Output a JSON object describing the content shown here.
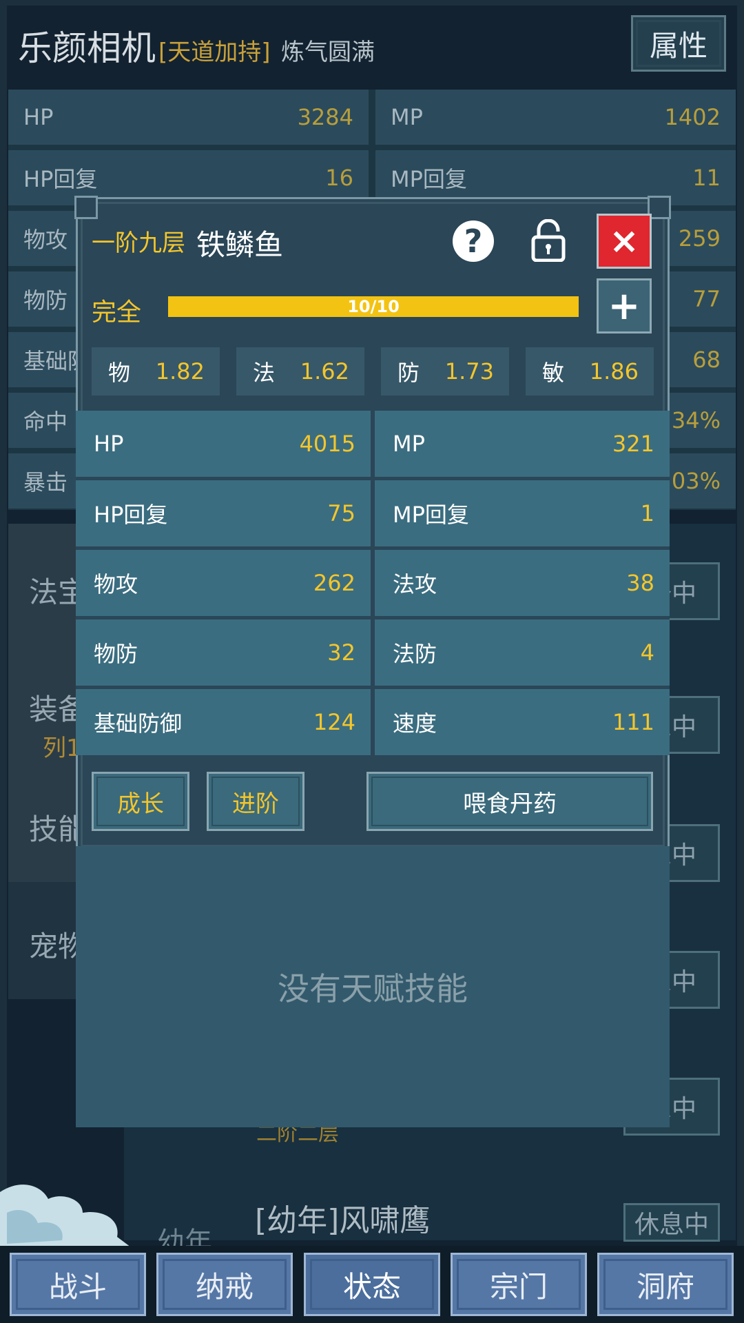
{
  "background": {
    "character_name": "乐颜相机",
    "tag": "[天道加持]",
    "realm": "炼气圆满",
    "attr_button": "属性",
    "stats": [
      {
        "label": "HP",
        "value": "3284"
      },
      {
        "label": "MP",
        "value": "1402"
      },
      {
        "label": "HP回复",
        "value": "16"
      },
      {
        "label": "MP回复",
        "value": "11"
      },
      {
        "label": "物攻",
        "value": ""
      },
      {
        "label": "",
        "value": "259"
      },
      {
        "label": "物防",
        "value": ""
      },
      {
        "label": "",
        "value": "77"
      },
      {
        "label": "基础防",
        "value": ""
      },
      {
        "label": "",
        "value": "68"
      },
      {
        "label": "命中",
        "value": ""
      },
      {
        "label": "",
        "value": ".34%"
      },
      {
        "label": "暴击",
        "value": ""
      },
      {
        "label": "",
        "value": ".03%"
      }
    ],
    "sidebar": {
      "fabao": "法宝",
      "equip": "装备",
      "equip_sub": "列1",
      "skill": "技能",
      "pet": "宠物"
    },
    "status_buttons": [
      "备中",
      "息中",
      "息中",
      "息中",
      "息中",
      "休息中"
    ],
    "pet_entry": {
      "name": "[幼年]风啸鹰",
      "age": "幼年",
      "level": "二阶二层"
    }
  },
  "dialog": {
    "rank": "一阶九层",
    "name": "铁鳞鱼",
    "help_glyph": "?",
    "close_glyph": "×",
    "plus_glyph": "+",
    "progress": {
      "label": "完全",
      "current": 10,
      "max": 10,
      "text": "10/10"
    },
    "growth": [
      {
        "label": "物",
        "value": "1.82"
      },
      {
        "label": "法",
        "value": "1.62"
      },
      {
        "label": "防",
        "value": "1.73"
      },
      {
        "label": "敏",
        "value": "1.86"
      }
    ],
    "stats": [
      {
        "label": "HP",
        "value": "4015"
      },
      {
        "label": "MP",
        "value": "321"
      },
      {
        "label": "HP回复",
        "value": "75"
      },
      {
        "label": "MP回复",
        "value": "1"
      },
      {
        "label": "物攻",
        "value": "262"
      },
      {
        "label": "法攻",
        "value": "38"
      },
      {
        "label": "物防",
        "value": "32"
      },
      {
        "label": "法防",
        "value": "4"
      },
      {
        "label": "基础防御",
        "value": "124"
      },
      {
        "label": "速度",
        "value": "111"
      }
    ],
    "buttons": {
      "grow": "成长",
      "advance": "进阶",
      "feed": "喂食丹药"
    },
    "no_talent": "没有天赋技能"
  },
  "nav": [
    "战斗",
    "纳戒",
    "状态",
    "宗门",
    "洞府"
  ],
  "colors": {
    "accent_gold": "#f4c62b",
    "close_red": "#e0262e",
    "panel": "#3b6d80",
    "nav_blue": "#5577a6"
  }
}
